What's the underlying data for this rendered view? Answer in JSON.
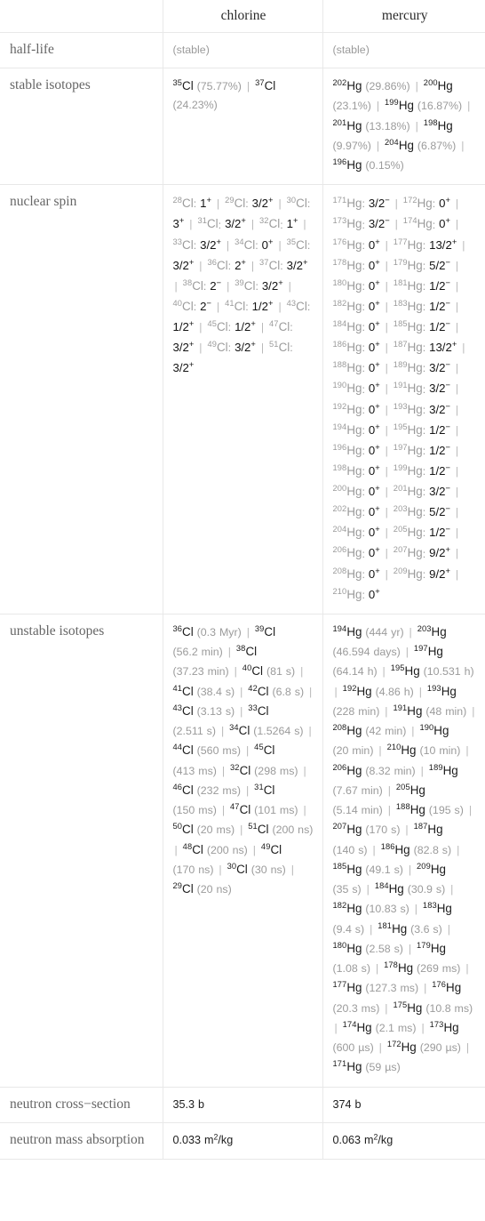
{
  "table": {
    "columns": [
      "",
      "chlorine",
      "mercury"
    ],
    "rows": [
      {
        "label": "half-life",
        "chlorine": {
          "kind": "muted",
          "text": "(stable)"
        },
        "mercury": {
          "kind": "muted",
          "text": "(stable)"
        }
      },
      {
        "label": "stable isotopes",
        "chlorine": {
          "kind": "isotope-list",
          "items": [
            {
              "mass": "35",
              "symbol": "Cl",
              "value": "(75.77%)"
            },
            {
              "mass": "37",
              "symbol": "Cl",
              "value": "(24.23%)"
            }
          ]
        },
        "mercury": {
          "kind": "isotope-list",
          "items": [
            {
              "mass": "202",
              "symbol": "Hg",
              "value": "(29.86%)"
            },
            {
              "mass": "200",
              "symbol": "Hg",
              "value": "(23.1%)"
            },
            {
              "mass": "199",
              "symbol": "Hg",
              "value": "(16.87%)"
            },
            {
              "mass": "201",
              "symbol": "Hg",
              "value": "(13.18%)"
            },
            {
              "mass": "198",
              "symbol": "Hg",
              "value": "(9.97%)"
            },
            {
              "mass": "204",
              "symbol": "Hg",
              "value": "(6.87%)"
            },
            {
              "mass": "196",
              "symbol": "Hg",
              "value": "(0.15%)"
            }
          ]
        }
      },
      {
        "label": "nuclear spin",
        "chlorine": {
          "kind": "spin-list",
          "items": [
            {
              "mass": "28",
              "symbol": "Cl",
              "spin": "1",
              "sign": "+"
            },
            {
              "mass": "29",
              "symbol": "Cl",
              "spin": "3/2",
              "sign": "+"
            },
            {
              "mass": "30",
              "symbol": "Cl",
              "spin": "3",
              "sign": "+"
            },
            {
              "mass": "31",
              "symbol": "Cl",
              "spin": "3/2",
              "sign": "+"
            },
            {
              "mass": "32",
              "symbol": "Cl",
              "spin": "1",
              "sign": "+"
            },
            {
              "mass": "33",
              "symbol": "Cl",
              "spin": "3/2",
              "sign": "+"
            },
            {
              "mass": "34",
              "symbol": "Cl",
              "spin": "0",
              "sign": "+"
            },
            {
              "mass": "35",
              "symbol": "Cl",
              "spin": "3/2",
              "sign": "+"
            },
            {
              "mass": "36",
              "symbol": "Cl",
              "spin": "2",
              "sign": "+"
            },
            {
              "mass": "37",
              "symbol": "Cl",
              "spin": "3/2",
              "sign": "+"
            },
            {
              "mass": "38",
              "symbol": "Cl",
              "spin": "2",
              "sign": "−"
            },
            {
              "mass": "39",
              "symbol": "Cl",
              "spin": "3/2",
              "sign": "+"
            },
            {
              "mass": "40",
              "symbol": "Cl",
              "spin": "2",
              "sign": "−"
            },
            {
              "mass": "41",
              "symbol": "Cl",
              "spin": "1/2",
              "sign": "+"
            },
            {
              "mass": "43",
              "symbol": "Cl",
              "spin": "1/2",
              "sign": "+"
            },
            {
              "mass": "45",
              "symbol": "Cl",
              "spin": "1/2",
              "sign": "+"
            },
            {
              "mass": "47",
              "symbol": "Cl",
              "spin": "3/2",
              "sign": "+"
            },
            {
              "mass": "49",
              "symbol": "Cl",
              "spin": "3/2",
              "sign": "+"
            },
            {
              "mass": "51",
              "symbol": "Cl",
              "spin": "3/2",
              "sign": "+"
            }
          ]
        },
        "mercury": {
          "kind": "spin-list",
          "items": [
            {
              "mass": "171",
              "symbol": "Hg",
              "spin": "3/2",
              "sign": "−"
            },
            {
              "mass": "172",
              "symbol": "Hg",
              "spin": "0",
              "sign": "+"
            },
            {
              "mass": "173",
              "symbol": "Hg",
              "spin": "3/2",
              "sign": "−"
            },
            {
              "mass": "174",
              "symbol": "Hg",
              "spin": "0",
              "sign": "+"
            },
            {
              "mass": "176",
              "symbol": "Hg",
              "spin": "0",
              "sign": "+"
            },
            {
              "mass": "177",
              "symbol": "Hg",
              "spin": "13/2",
              "sign": "+"
            },
            {
              "mass": "178",
              "symbol": "Hg",
              "spin": "0",
              "sign": "+"
            },
            {
              "mass": "179",
              "symbol": "Hg",
              "spin": "5/2",
              "sign": "−"
            },
            {
              "mass": "180",
              "symbol": "Hg",
              "spin": "0",
              "sign": "+"
            },
            {
              "mass": "181",
              "symbol": "Hg",
              "spin": "1/2",
              "sign": "−"
            },
            {
              "mass": "182",
              "symbol": "Hg",
              "spin": "0",
              "sign": "+"
            },
            {
              "mass": "183",
              "symbol": "Hg",
              "spin": "1/2",
              "sign": "−"
            },
            {
              "mass": "184",
              "symbol": "Hg",
              "spin": "0",
              "sign": "+"
            },
            {
              "mass": "185",
              "symbol": "Hg",
              "spin": "1/2",
              "sign": "−"
            },
            {
              "mass": "186",
              "symbol": "Hg",
              "spin": "0",
              "sign": "+"
            },
            {
              "mass": "187",
              "symbol": "Hg",
              "spin": "13/2",
              "sign": "+"
            },
            {
              "mass": "188",
              "symbol": "Hg",
              "spin": "0",
              "sign": "+"
            },
            {
              "mass": "189",
              "symbol": "Hg",
              "spin": "3/2",
              "sign": "−"
            },
            {
              "mass": "190",
              "symbol": "Hg",
              "spin": "0",
              "sign": "+"
            },
            {
              "mass": "191",
              "symbol": "Hg",
              "spin": "3/2",
              "sign": "−"
            },
            {
              "mass": "192",
              "symbol": "Hg",
              "spin": "0",
              "sign": "+"
            },
            {
              "mass": "193",
              "symbol": "Hg",
              "spin": "3/2",
              "sign": "−"
            },
            {
              "mass": "194",
              "symbol": "Hg",
              "spin": "0",
              "sign": "+"
            },
            {
              "mass": "195",
              "symbol": "Hg",
              "spin": "1/2",
              "sign": "−"
            },
            {
              "mass": "196",
              "symbol": "Hg",
              "spin": "0",
              "sign": "+"
            },
            {
              "mass": "197",
              "symbol": "Hg",
              "spin": "1/2",
              "sign": "−"
            },
            {
              "mass": "198",
              "symbol": "Hg",
              "spin": "0",
              "sign": "+"
            },
            {
              "mass": "199",
              "symbol": "Hg",
              "spin": "1/2",
              "sign": "−"
            },
            {
              "mass": "200",
              "symbol": "Hg",
              "spin": "0",
              "sign": "+"
            },
            {
              "mass": "201",
              "symbol": "Hg",
              "spin": "3/2",
              "sign": "−"
            },
            {
              "mass": "202",
              "symbol": "Hg",
              "spin": "0",
              "sign": "+"
            },
            {
              "mass": "203",
              "symbol": "Hg",
              "spin": "5/2",
              "sign": "−"
            },
            {
              "mass": "204",
              "symbol": "Hg",
              "spin": "0",
              "sign": "+"
            },
            {
              "mass": "205",
              "symbol": "Hg",
              "spin": "1/2",
              "sign": "−"
            },
            {
              "mass": "206",
              "symbol": "Hg",
              "spin": "0",
              "sign": "+"
            },
            {
              "mass": "207",
              "symbol": "Hg",
              "spin": "9/2",
              "sign": "+"
            },
            {
              "mass": "208",
              "symbol": "Hg",
              "spin": "0",
              "sign": "+"
            },
            {
              "mass": "209",
              "symbol": "Hg",
              "spin": "9/2",
              "sign": "+"
            },
            {
              "mass": "210",
              "symbol": "Hg",
              "spin": "0",
              "sign": "+"
            }
          ]
        }
      },
      {
        "label": "unstable isotopes",
        "chlorine": {
          "kind": "isotope-list",
          "items": [
            {
              "mass": "36",
              "symbol": "Cl",
              "value": "(0.3 Myr)"
            },
            {
              "mass": "39",
              "symbol": "Cl",
              "value": "(56.2 min)"
            },
            {
              "mass": "38",
              "symbol": "Cl",
              "value": "(37.23 min)"
            },
            {
              "mass": "40",
              "symbol": "Cl",
              "value": "(81 s)"
            },
            {
              "mass": "41",
              "symbol": "Cl",
              "value": "(38.4 s)"
            },
            {
              "mass": "42",
              "symbol": "Cl",
              "value": "(6.8 s)"
            },
            {
              "mass": "43",
              "symbol": "Cl",
              "value": "(3.13 s)"
            },
            {
              "mass": "33",
              "symbol": "Cl",
              "value": "(2.511 s)"
            },
            {
              "mass": "34",
              "symbol": "Cl",
              "value": "(1.5264 s)"
            },
            {
              "mass": "44",
              "symbol": "Cl",
              "value": "(560 ms)"
            },
            {
              "mass": "45",
              "symbol": "Cl",
              "value": "(413 ms)"
            },
            {
              "mass": "32",
              "symbol": "Cl",
              "value": "(298 ms)"
            },
            {
              "mass": "46",
              "symbol": "Cl",
              "value": "(232 ms)"
            },
            {
              "mass": "31",
              "symbol": "Cl",
              "value": "(150 ms)"
            },
            {
              "mass": "47",
              "symbol": "Cl",
              "value": "(101 ms)"
            },
            {
              "mass": "50",
              "symbol": "Cl",
              "value": "(20 ms)"
            },
            {
              "mass": "51",
              "symbol": "Cl",
              "value": "(200 ns)"
            },
            {
              "mass": "48",
              "symbol": "Cl",
              "value": "(200 ns)"
            },
            {
              "mass": "49",
              "symbol": "Cl",
              "value": "(170 ns)"
            },
            {
              "mass": "30",
              "symbol": "Cl",
              "value": "(30 ns)"
            },
            {
              "mass": "29",
              "symbol": "Cl",
              "value": "(20 ns)"
            }
          ]
        },
        "mercury": {
          "kind": "isotope-list",
          "items": [
            {
              "mass": "194",
              "symbol": "Hg",
              "value": "(444 yr)"
            },
            {
              "mass": "203",
              "symbol": "Hg",
              "value": "(46.594 days)"
            },
            {
              "mass": "197",
              "symbol": "Hg",
              "value": "(64.14 h)"
            },
            {
              "mass": "195",
              "symbol": "Hg",
              "value": "(10.531 h)"
            },
            {
              "mass": "192",
              "symbol": "Hg",
              "value": "(4.86 h)"
            },
            {
              "mass": "193",
              "symbol": "Hg",
              "value": "(228 min)"
            },
            {
              "mass": "191",
              "symbol": "Hg",
              "value": "(48 min)"
            },
            {
              "mass": "208",
              "symbol": "Hg",
              "value": "(42 min)"
            },
            {
              "mass": "190",
              "symbol": "Hg",
              "value": "(20 min)"
            },
            {
              "mass": "210",
              "symbol": "Hg",
              "value": "(10 min)"
            },
            {
              "mass": "206",
              "symbol": "Hg",
              "value": "(8.32 min)"
            },
            {
              "mass": "189",
              "symbol": "Hg",
              "value": "(7.67 min)"
            },
            {
              "mass": "205",
              "symbol": "Hg",
              "value": "(5.14 min)"
            },
            {
              "mass": "188",
              "symbol": "Hg",
              "value": "(195 s)"
            },
            {
              "mass": "207",
              "symbol": "Hg",
              "value": "(170 s)"
            },
            {
              "mass": "187",
              "symbol": "Hg",
              "value": "(140 s)"
            },
            {
              "mass": "186",
              "symbol": "Hg",
              "value": "(82.8 s)"
            },
            {
              "mass": "185",
              "symbol": "Hg",
              "value": "(49.1 s)"
            },
            {
              "mass": "209",
              "symbol": "Hg",
              "value": "(35 s)"
            },
            {
              "mass": "184",
              "symbol": "Hg",
              "value": "(30.9 s)"
            },
            {
              "mass": "182",
              "symbol": "Hg",
              "value": "(10.83 s)"
            },
            {
              "mass": "183",
              "symbol": "Hg",
              "value": "(9.4 s)"
            },
            {
              "mass": "181",
              "symbol": "Hg",
              "value": "(3.6 s)"
            },
            {
              "mass": "180",
              "symbol": "Hg",
              "value": "(2.58 s)"
            },
            {
              "mass": "179",
              "symbol": "Hg",
              "value": "(1.08 s)"
            },
            {
              "mass": "178",
              "symbol": "Hg",
              "value": "(269 ms)"
            },
            {
              "mass": "177",
              "symbol": "Hg",
              "value": "(127.3 ms)"
            },
            {
              "mass": "176",
              "symbol": "Hg",
              "value": "(20.3 ms)"
            },
            {
              "mass": "175",
              "symbol": "Hg",
              "value": "(10.8 ms)"
            },
            {
              "mass": "174",
              "symbol": "Hg",
              "value": "(2.1 ms)"
            },
            {
              "mass": "173",
              "symbol": "Hg",
              "value": "(600 µs)"
            },
            {
              "mass": "172",
              "symbol": "Hg",
              "value": "(290 µs)"
            },
            {
              "mass": "171",
              "symbol": "Hg",
              "value": "(59 µs)"
            }
          ]
        }
      },
      {
        "label": "neutron cross−section",
        "chlorine": {
          "kind": "plain",
          "text": "35.3 b"
        },
        "mercury": {
          "kind": "plain",
          "text": "374 b"
        }
      },
      {
        "label": "neutron mass absorption",
        "chlorine": {
          "kind": "unit-sq",
          "number": "0.033",
          "unit": "m",
          "sup": "2",
          "denom": "/kg"
        },
        "mercury": {
          "kind": "unit-sq",
          "number": "0.063",
          "unit": "m",
          "sup": "2",
          "denom": "/kg"
        }
      }
    ]
  },
  "separator": "|"
}
